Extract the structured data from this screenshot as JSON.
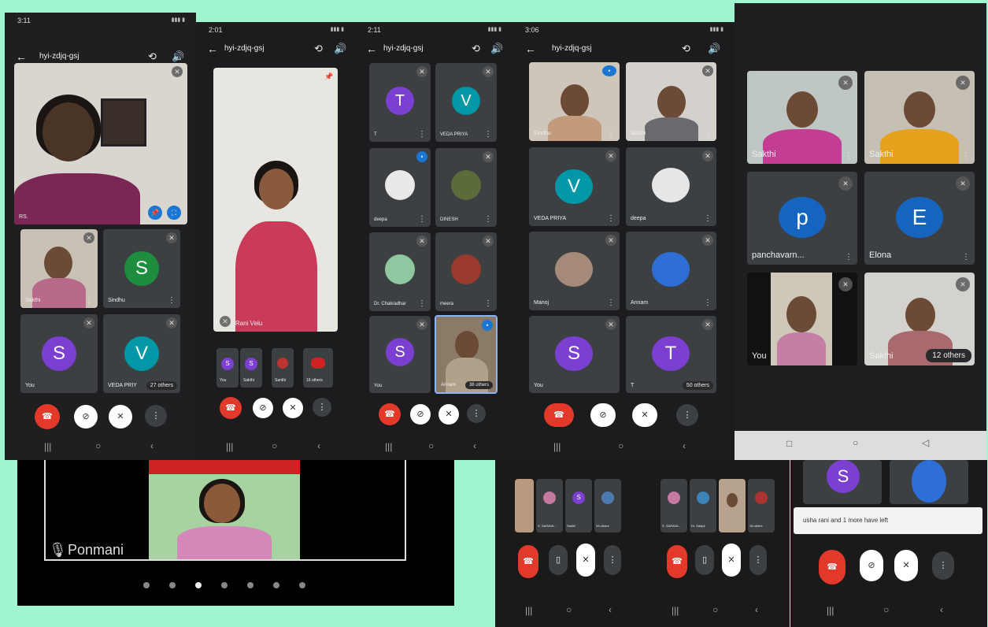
{
  "colors": {
    "end_call": "#e3392b",
    "avatar_green": "#1e8e3e",
    "avatar_purple": "#7b3fd1",
    "avatar_teal": "#0097a7",
    "avatar_blue": "#1565c0",
    "bg": "#9ff5d0"
  },
  "phone1": {
    "time": "3:11",
    "meeting_code": "hyi-zdjq-gsj",
    "main_name": "RS.",
    "tiles": [
      {
        "name": "Sakthi"
      },
      {
        "name": "Sindhu",
        "initial": "S"
      },
      {
        "name": "You",
        "initial": "S"
      },
      {
        "name": "VEDA PRIY",
        "initial": "V",
        "others": "27 others"
      }
    ]
  },
  "phone2": {
    "time": "2:01",
    "meeting_code": "hyi-zdjq-gsj",
    "main_name": "Rani Velu",
    "thumbs": [
      {
        "name": "You",
        "initial": "S"
      },
      {
        "name": "Sakthi",
        "initial": "S"
      },
      {
        "name": "Santhi"
      },
      {
        "name": "16 others"
      }
    ]
  },
  "phone3": {
    "time": "2:11",
    "meeting_code": "hyi-zdjq-gsj",
    "tiles": [
      {
        "name": "T",
        "initial": "T"
      },
      {
        "name": "VEDA PRIYA",
        "initial": "V"
      },
      {
        "name": "deepa"
      },
      {
        "name": "DINESH"
      },
      {
        "name": "Dr. Chakradhar"
      },
      {
        "name": "meera"
      },
      {
        "name": "You",
        "initial": "S"
      },
      {
        "name": "Annam",
        "others": "38 others"
      }
    ]
  },
  "phone4": {
    "time": "3:06",
    "meeting_code": "hyi-zdjq-gsj",
    "tiles": [
      {
        "name": "Sindhu"
      },
      {
        "name": "Sakthi"
      },
      {
        "name": "VEDA PRIYA",
        "initial": "V"
      },
      {
        "name": "deepa"
      },
      {
        "name": "Manoj"
      },
      {
        "name": "Annam"
      },
      {
        "name": "You",
        "initial": "S"
      },
      {
        "name": "T",
        "initial": "T",
        "others": "50 others"
      }
    ]
  },
  "phone5": {
    "tiles": [
      {
        "name": "Sakthi"
      },
      {
        "name": "Sakthi"
      },
      {
        "name": "panchavarn...",
        "initial": "p"
      },
      {
        "name": "Elona",
        "initial": "E"
      },
      {
        "name": "You"
      },
      {
        "name": "Sakthi",
        "others": "12 others"
      }
    ]
  },
  "bottom_left": {
    "name": "Ponmani"
  },
  "bottom_mid1": {
    "thumbs": [
      {
        "name": ""
      },
      {
        "name": "S. SARAVA..."
      },
      {
        "name": "Sakthi",
        "initial": "S"
      },
      {
        "name": "26 others"
      }
    ]
  },
  "bottom_mid2": {
    "thumbs": [
      {
        "name": "S. SARAVA..."
      },
      {
        "name": "Dr. Sanjul"
      },
      {
        "name": ""
      },
      {
        "name": "18 others"
      }
    ]
  },
  "bottom_right": {
    "avatar_initial": "S",
    "toast": "usha rani and 1 more have left"
  },
  "icons": {
    "end": "end-call-icon",
    "cam": "camera-off-icon",
    "mic": "mic-off-icon",
    "more": "more-icon"
  }
}
